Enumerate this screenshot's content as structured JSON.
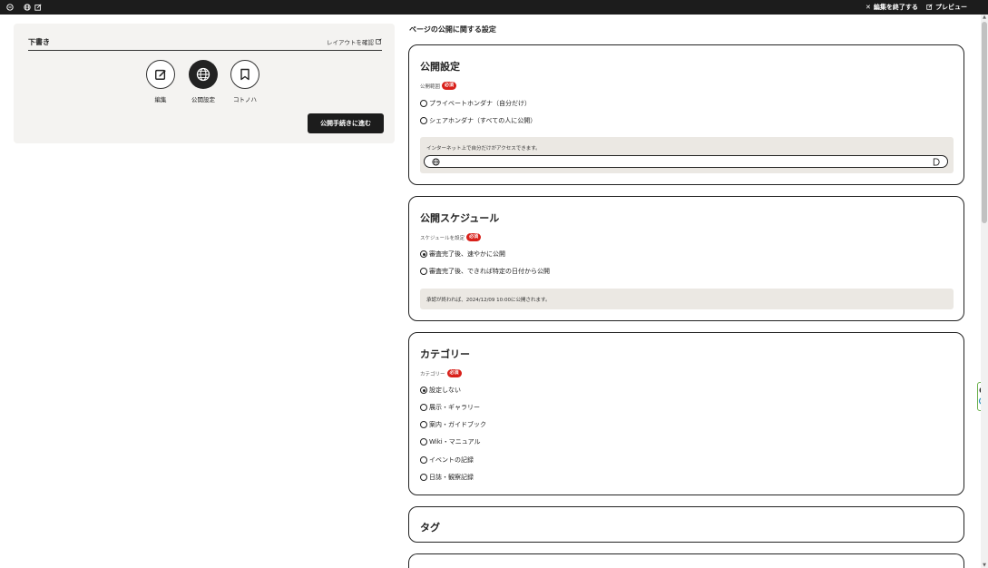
{
  "topbar": {
    "left_icons": [
      "copy-circle-icon",
      "globe-icon",
      "edit-icon"
    ],
    "end_edit_label": "編集を終了する",
    "preview_label": "プレビュー"
  },
  "left_panel": {
    "title": "下書き",
    "layout_link": "レイアウトを確認",
    "steps": [
      {
        "label": "編集",
        "icon": "edit-icon",
        "active": false
      },
      {
        "label": "公開設定",
        "icon": "globe-icon",
        "active": true
      },
      {
        "label": "コトノハ",
        "icon": "bookmark-icon",
        "active": false
      }
    ],
    "proceed_button": "公開手続きに進む"
  },
  "page_heading": "ページの公開に関する設定",
  "required_badge": "必須",
  "visibility": {
    "title": "公開設定",
    "field_label": "公開範囲",
    "options": [
      "プライベートホンダナ（自分だけ）",
      "シェアホンダナ（すべての人に公開）"
    ],
    "info_text": "インターネット上で自分だけがアクセスできます。"
  },
  "schedule": {
    "title": "公開スケジュール",
    "field_label": "スケジュールを設定",
    "options": [
      "審査完了後、速やかに公開",
      "審査完了後、できれば特定の日付から公開"
    ],
    "selected_index": 0,
    "info_text": "承認が終われば、2024/12/09 10:00に公開されます。"
  },
  "category": {
    "title": "カテゴリー",
    "field_label": "カテゴリー",
    "options": [
      "設定しない",
      "展示・ギャラリー",
      "案内・ガイドブック",
      "Wiki・マニュアル",
      "イベントの記録",
      "日誌・観察記録"
    ],
    "selected_index": 0
  },
  "tags": {
    "title": "タグ"
  },
  "colors": {
    "topbar": "#1c1c1c",
    "panel_bg": "#f4f3f1",
    "info_bg": "#ebe8e3",
    "required": "#d8201a"
  }
}
